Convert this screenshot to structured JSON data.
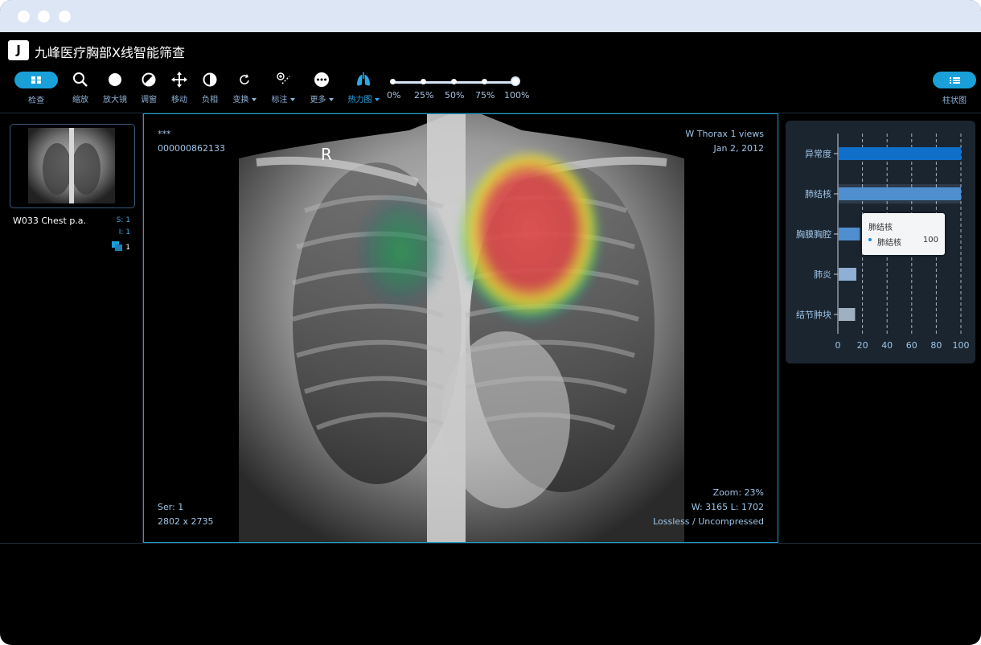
{
  "app": {
    "logo": "J",
    "title": "九峰医疗胸部X线智能筛查"
  },
  "toolbar": {
    "exam_label": "检查",
    "tools": [
      {
        "label": "缩放",
        "icon": "magnifier-icon"
      },
      {
        "label": "放大镜",
        "icon": "magnifier-glass-icon"
      },
      {
        "label": "调窗",
        "icon": "contrast-window-icon"
      },
      {
        "label": "移动",
        "icon": "move-arrows-icon"
      },
      {
        "label": "负相",
        "icon": "invert-icon"
      },
      {
        "label": "变换",
        "icon": "rotate-icon"
      },
      {
        "label": "标注",
        "icon": "annotate-icon"
      },
      {
        "label": "更多",
        "icon": "more-icon"
      },
      {
        "label": "热力图",
        "icon": "lungs-icon"
      }
    ],
    "opacity_ticks": [
      "0%",
      "25%",
      "50%",
      "75%",
      "100%"
    ],
    "opacity_value": 1.0,
    "chart_label": "柱状图"
  },
  "series": {
    "name": "W033 Chest p.a.",
    "s": "S: 1",
    "i": "I: 1",
    "count": "1"
  },
  "viewer": {
    "patient": "***",
    "id": "000000862133",
    "study": "W Thorax 1 views",
    "date": "Jan 2, 2012",
    "ser": "Ser: 1",
    "dims": "2802 x 2735",
    "zoom": "Zoom: 23%",
    "wl": "W: 3165 L: 1702",
    "compression": "Lossless / Uncompressed",
    "marker": "R"
  },
  "tooltip": {
    "title": "肺结核",
    "series": "肺结核",
    "value": "100"
  },
  "colors": {
    "accent": "#1aa0d8",
    "bar_primary": "#0f6fc9",
    "bar_secondary": "#4f8fd0",
    "bar_light": "#8fb0d4",
    "bar_gray": "#9fb0c2"
  },
  "chart_data": {
    "type": "bar",
    "orientation": "horizontal",
    "categories": [
      "异常度",
      "肺结核",
      "胸膜胸腔",
      "肺炎",
      "结节肿块"
    ],
    "values": [
      100,
      100,
      18,
      15,
      14
    ],
    "xlim": [
      0,
      100
    ],
    "xticks": [
      "0",
      "20",
      "40",
      "60",
      "80",
      "100"
    ],
    "grid": true
  }
}
